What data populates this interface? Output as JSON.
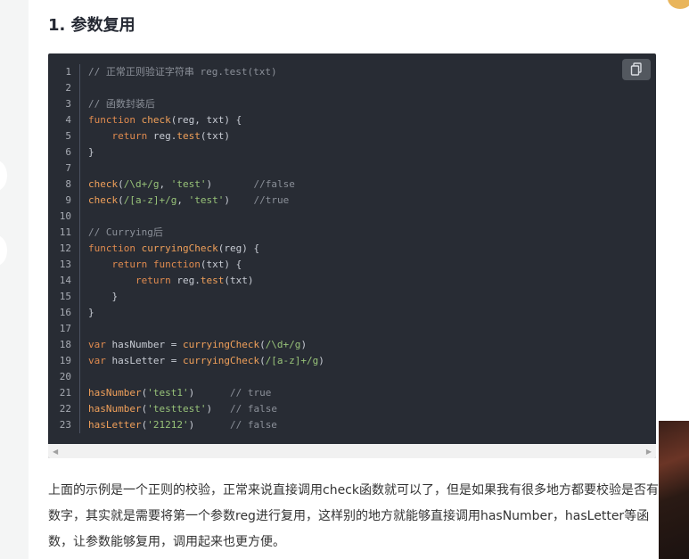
{
  "section": {
    "title": "1. 参数复用"
  },
  "code": {
    "copy_icon": "copy-icon",
    "lines": [
      {
        "n": "1",
        "html": "<span class='c'>// 正常正则验证字符串 reg.test(txt)</span>"
      },
      {
        "n": "2",
        "html": ""
      },
      {
        "n": "3",
        "html": "<span class='c'>// 函数封装后</span>"
      },
      {
        "n": "4",
        "html": "<span class='k'>function</span> <span class='f'>check</span>(reg, txt) {"
      },
      {
        "n": "5",
        "html": "    <span class='k'>return</span> reg.<span class='f'>test</span>(txt)"
      },
      {
        "n": "6",
        "html": "}"
      },
      {
        "n": "7",
        "html": ""
      },
      {
        "n": "8",
        "html": "<span class='f'>check</span>(<span class='s'>/\\d+/g</span>, <span class='s'>'test'</span>)       <span class='c'>//false</span>"
      },
      {
        "n": "9",
        "html": "<span class='f'>check</span>(<span class='s'>/[a-z]+/g</span>, <span class='s'>'test'</span>)    <span class='c'>//true</span>"
      },
      {
        "n": "10",
        "html": ""
      },
      {
        "n": "11",
        "html": "<span class='c'>// Currying后</span>"
      },
      {
        "n": "12",
        "html": "<span class='k'>function</span> <span class='f'>curryingCheck</span>(reg) {"
      },
      {
        "n": "13",
        "html": "    <span class='k'>return</span> <span class='k'>function</span>(txt) {"
      },
      {
        "n": "14",
        "html": "        <span class='k'>return</span> reg.<span class='f'>test</span>(txt)"
      },
      {
        "n": "15",
        "html": "    }"
      },
      {
        "n": "16",
        "html": "}"
      },
      {
        "n": "17",
        "html": ""
      },
      {
        "n": "18",
        "html": "<span class='k'>var</span> hasNumber = <span class='f'>curryingCheck</span>(<span class='s'>/\\d+/g</span>)"
      },
      {
        "n": "19",
        "html": "<span class='k'>var</span> hasLetter = <span class='f'>curryingCheck</span>(<span class='s'>/[a-z]+/g</span>)"
      },
      {
        "n": "20",
        "html": ""
      },
      {
        "n": "21",
        "html": "<span class='f'>hasNumber</span>(<span class='s'>'test1'</span>)      <span class='c'>// true</span>"
      },
      {
        "n": "22",
        "html": "<span class='f'>hasNumber</span>(<span class='s'>'testtest'</span>)   <span class='c'>// false</span>"
      },
      {
        "n": "23",
        "html": "<span class='f'>hasLetter</span>(<span class='s'>'21212'</span>)      <span class='c'>// false</span>"
      }
    ]
  },
  "scroll": {
    "left": "◀",
    "right": "▶"
  },
  "paragraph": "上面的示例是一个正则的校验，正常来说直接调用check函数就可以了，但是如果我有很多地方都要校验是否有数字，其实就是需要将第一个参数reg进行复用，这样别的地方就能够直接调用hasNumber，hasLetter等函数，让参数能够复用，调用起来也更方便。",
  "colors": {
    "code_bg": "#282c34",
    "keyword": "#e08b4f",
    "string": "#98c379",
    "comment": "#8b9099"
  }
}
